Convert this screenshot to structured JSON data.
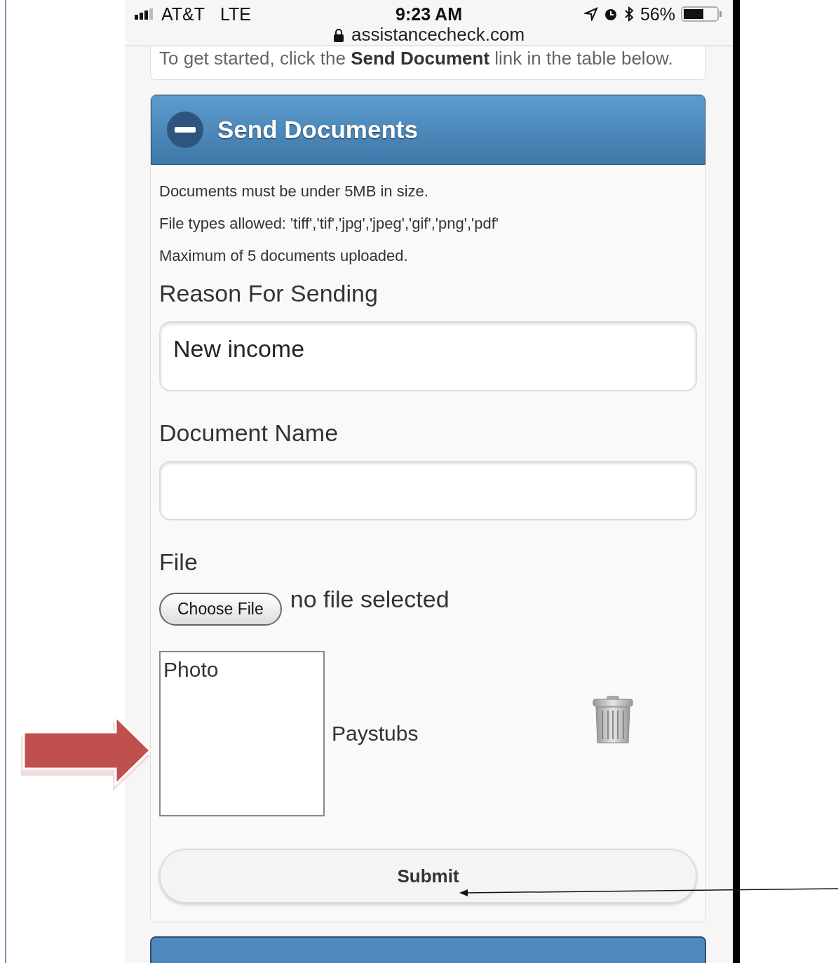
{
  "status_bar": {
    "carrier": "AT&T",
    "network": "LTE",
    "time": "9:23 AM",
    "battery": "56%"
  },
  "address_bar": {
    "url": "assistancecheck.com"
  },
  "intro": "To get started, click the **Send Document** link in the table below.",
  "panel": {
    "title": "Send Documents",
    "expanded": true,
    "notes": [
      "Documents must be under 5MB in size.",
      "File types allowed: 'tiff','tif','jpg','jpeg','gif','png','pdf'",
      "Maximum of 5 documents uploaded."
    ],
    "fields": [
      {
        "label": "Reason For Sending",
        "value": "New income"
      },
      {
        "label": "Document Name"
      }
    ],
    "file": {
      "label": "File",
      "button": "Choose File",
      "status": "no file selected"
    },
    "uploads": [
      {
        "thumbnail": "Photo",
        "name": "Paystubs"
      }
    ],
    "submit": "Submit"
  },
  "next_panel": {
    "expanded": false
  }
}
